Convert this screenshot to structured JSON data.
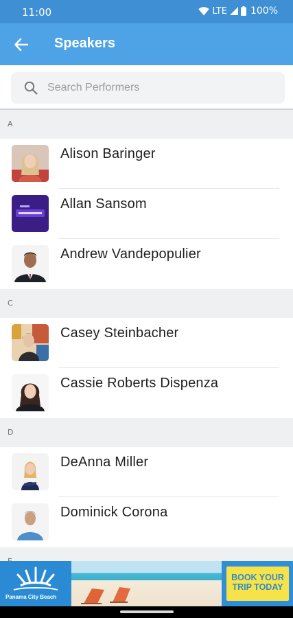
{
  "status_bar": {
    "time": "11:00",
    "network": "LTE",
    "battery": "100%"
  },
  "app_bar": {
    "title": "Speakers"
  },
  "search": {
    "placeholder": "Search Performers"
  },
  "sections": [
    {
      "letter": "A",
      "items": [
        {
          "name": "Alison Baringer"
        },
        {
          "name": "Allan Sansom"
        },
        {
          "name": "Andrew Vandepopulier"
        }
      ]
    },
    {
      "letter": "C",
      "items": [
        {
          "name": "Casey Steinbacher"
        },
        {
          "name": "Cassie Roberts Dispenza"
        }
      ]
    },
    {
      "letter": "D",
      "items": [
        {
          "name": "DeAnna Miller"
        },
        {
          "name": "Dominick Corona"
        }
      ]
    },
    {
      "letter": "E",
      "items": []
    }
  ],
  "ad": {
    "brand": "Panama City Beach",
    "cta_line1": "BOOK YOUR",
    "cta_line2": "TRIP TODAY"
  },
  "colors": {
    "status_bar": "#3f8fd4",
    "app_bar": "#4da3e6",
    "section_bg": "#eef0f2",
    "ad_cta_bg": "#f6e34a"
  }
}
